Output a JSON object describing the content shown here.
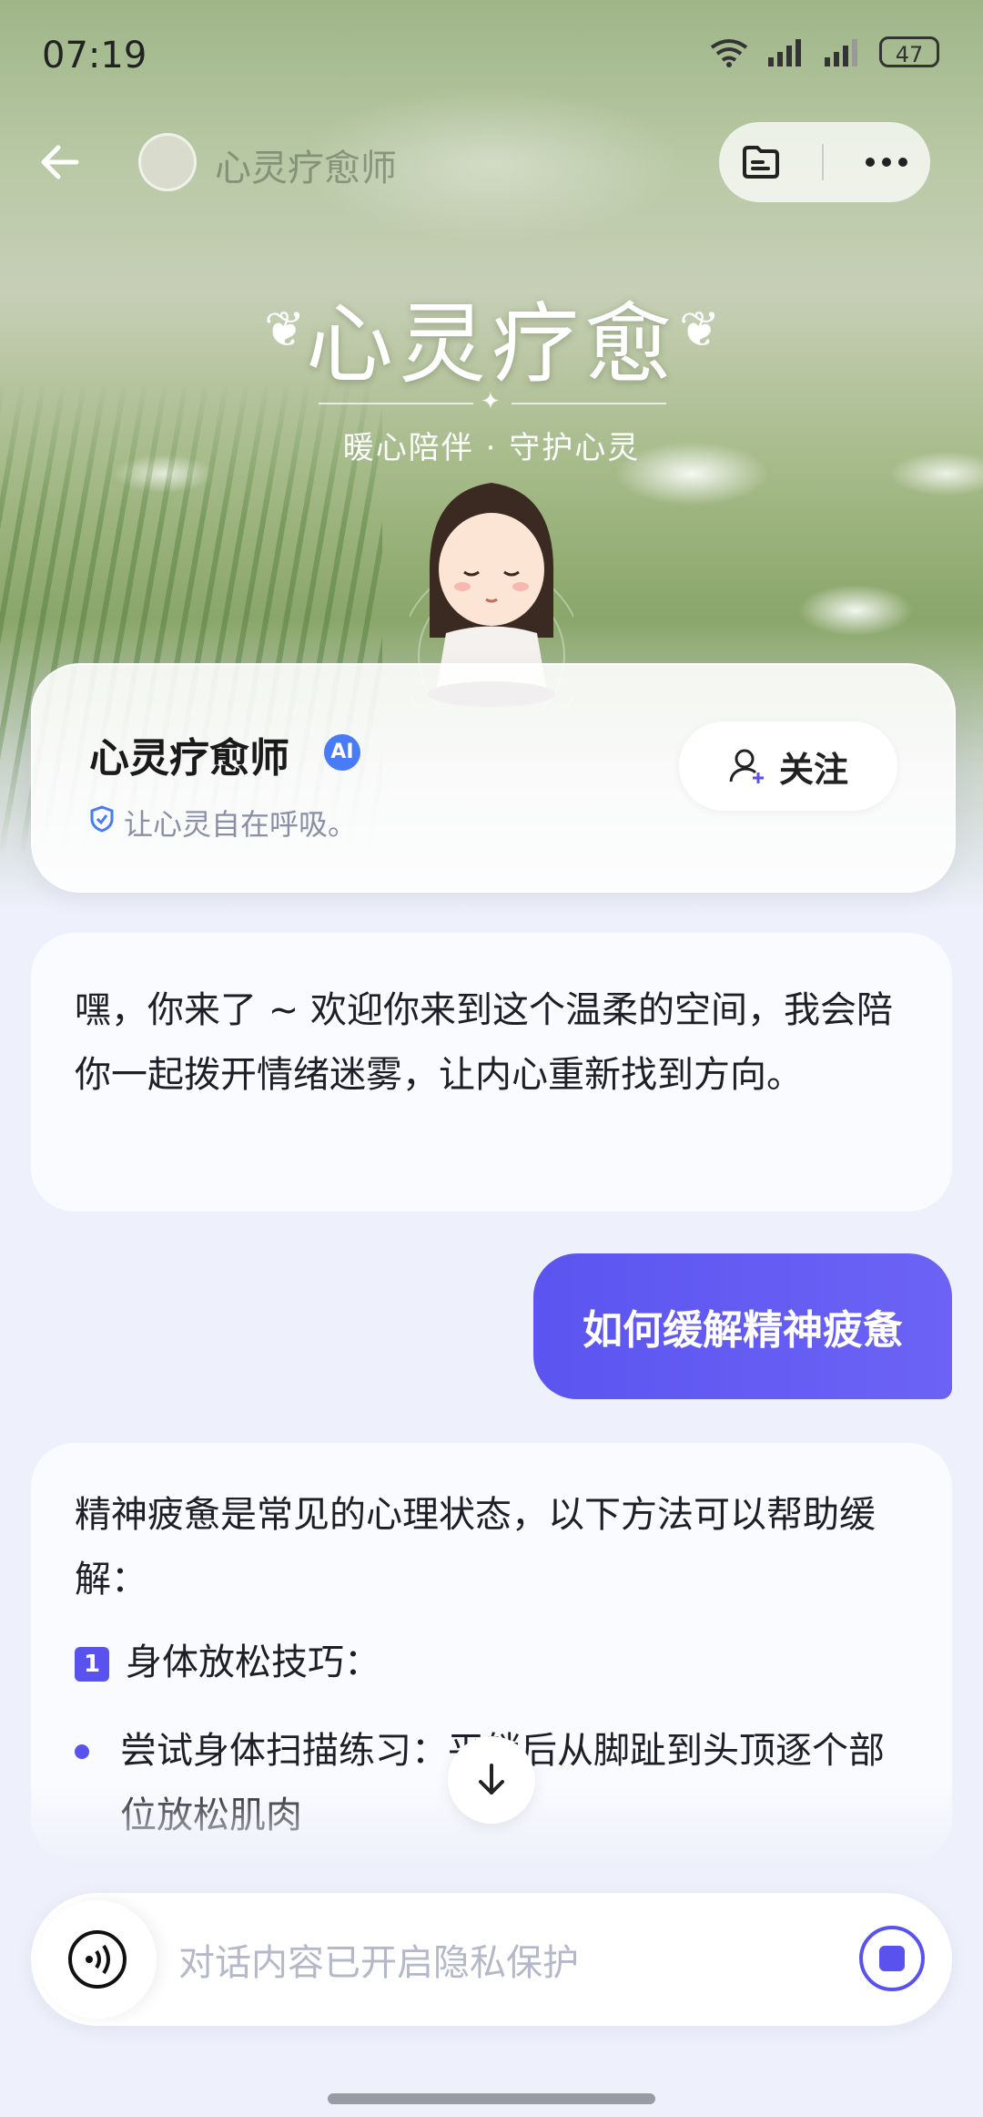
{
  "status_bar": {
    "time": "07:19",
    "battery": "47"
  },
  "header": {
    "nav_title": "心灵疗愈师"
  },
  "hero": {
    "title": "心灵疗愈",
    "subtitle": "暖心陪伴 · 守护心灵"
  },
  "profile": {
    "name": "心灵疗愈师",
    "ai_badge": "AI",
    "description": "让心灵自在呼吸。",
    "follow_label": "关注"
  },
  "messages": {
    "bot_1": "嘿，你来了 ~ 欢迎你来到这个温柔的空间，我会陪你一起拨开情绪迷雾，让内心重新找到方向。",
    "user_1": "如何缓解精神疲惫",
    "bot_2_intro": "精神疲惫是常见的心理状态，以下方法可以帮助缓解：",
    "bot_2_section_number": "1",
    "bot_2_section_title": "身体放松技巧：",
    "bot_2_bullet_1": "尝试身体扫描练习：平躺后从脚趾到头顶逐个部位放松肌肉"
  },
  "composer": {
    "placeholder": "对话内容已开启隐私保护"
  },
  "colors": {
    "accent": "#5a52ee",
    "user_bubble": "#6c63f5",
    "ai_badge": "#4a7bf7"
  }
}
